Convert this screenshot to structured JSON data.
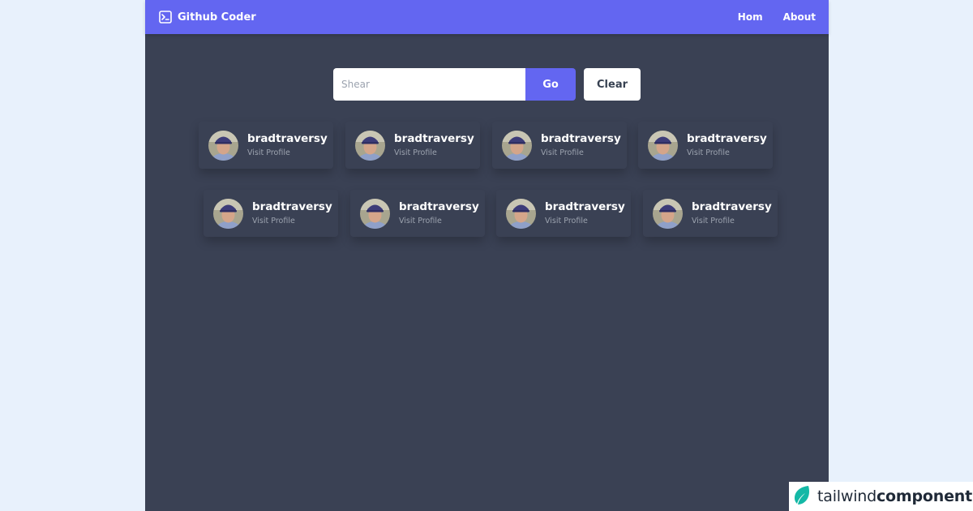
{
  "navbar": {
    "brand_icon": "terminal-icon",
    "brand_label": "Github Coder",
    "links": [
      "Hom",
      "About"
    ],
    "background": "#6366f1"
  },
  "search": {
    "placeholder": "Shear",
    "value": "",
    "go_label": "Go",
    "clear_label": "Clear"
  },
  "users": [
    {
      "username": "bradtraversy",
      "link_text": "Visit Profile"
    },
    {
      "username": "bradtraversy",
      "link_text": "Visit Profile"
    },
    {
      "username": "bradtraversy",
      "link_text": "Visit Profile"
    },
    {
      "username": "bradtraversy",
      "link_text": "Visit Profile"
    },
    {
      "username": "bradtraversy",
      "link_text": "Visit Profile"
    },
    {
      "username": "bradtraversy",
      "link_text": "Visit Profile"
    },
    {
      "username": "bradtraversy",
      "link_text": "Visit Profile"
    },
    {
      "username": "bradtraversy",
      "link_text": "Visit Profile"
    }
  ],
  "badge": {
    "icon": "tailwind-leaf-icon",
    "light_text": "tailwind",
    "bold_text": "components"
  },
  "colors": {
    "page_background": "#e8f1fc",
    "app_background": "#3a4154",
    "accent": "#6366f1"
  }
}
